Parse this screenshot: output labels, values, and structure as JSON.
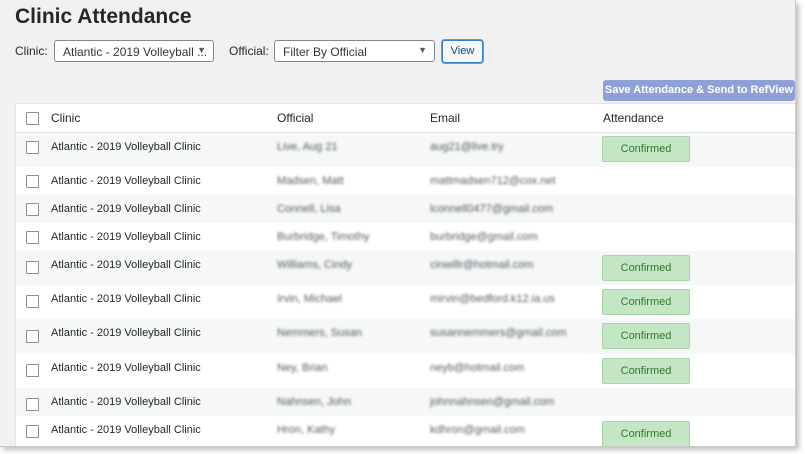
{
  "page": {
    "title": "Clinic Attendance"
  },
  "filters": {
    "clinic_label": "Clinic:",
    "clinic_value": "Atlantic - 2019 Volleyball ...",
    "official_label": "Official:",
    "official_value": "Filter By Official",
    "view_label": "View"
  },
  "actions": {
    "save_label": "Save Attendance & Send to RefView"
  },
  "table": {
    "headers": {
      "clinic": "Clinic",
      "official": "Official",
      "email": "Email",
      "attendance": "Attendance"
    },
    "rows": [
      {
        "clinic": "Atlantic - 2019 Volleyball Clinic",
        "official": "Live, Aug 21",
        "email": "aug21@live.try",
        "attendance": "Confirmed"
      },
      {
        "clinic": "Atlantic - 2019 Volleyball Clinic",
        "official": "Madsen, Matt",
        "email": "mattmadsen712@cox.net",
        "attendance": ""
      },
      {
        "clinic": "Atlantic - 2019 Volleyball Clinic",
        "official": "Connell, Lisa",
        "email": "lconnell0477@gmail.com",
        "attendance": ""
      },
      {
        "clinic": "Atlantic - 2019 Volleyball Clinic",
        "official": "Burbridge, Timothy",
        "email": "burbridge@gmail.com",
        "attendance": ""
      },
      {
        "clinic": "Atlantic - 2019 Volleyball Clinic",
        "official": "Williams, Cindy",
        "email": "cinwillr@hotmail.com",
        "attendance": "Confirmed"
      },
      {
        "clinic": "Atlantic - 2019 Volleyball Clinic",
        "official": "Irvin, Michael",
        "email": "mirvin@bedford.k12.ia.us",
        "attendance": "Confirmed"
      },
      {
        "clinic": "Atlantic - 2019 Volleyball Clinic",
        "official": "Nemmers, Susan",
        "email": "susannemmers@gmail.com",
        "attendance": "Confirmed"
      },
      {
        "clinic": "Atlantic - 2019 Volleyball Clinic",
        "official": "Ney, Brian",
        "email": "neyb@hotmail.com",
        "attendance": "Confirmed"
      },
      {
        "clinic": "Atlantic - 2019 Volleyball Clinic",
        "official": "Nahnsen, John",
        "email": "johnnahnsen@gmail.com",
        "attendance": ""
      },
      {
        "clinic": "Atlantic - 2019 Volleyball Clinic",
        "official": "Hron, Kathy",
        "email": "kdhron@gmail.com",
        "attendance": "Confirmed"
      }
    ]
  },
  "colors": {
    "background": "#f1f1f1",
    "save_button": "#8fa0d6",
    "confirmed_badge": "#c4e6c4",
    "confirmed_text": "#2f7a2f",
    "view_button_border": "#3581c5"
  }
}
